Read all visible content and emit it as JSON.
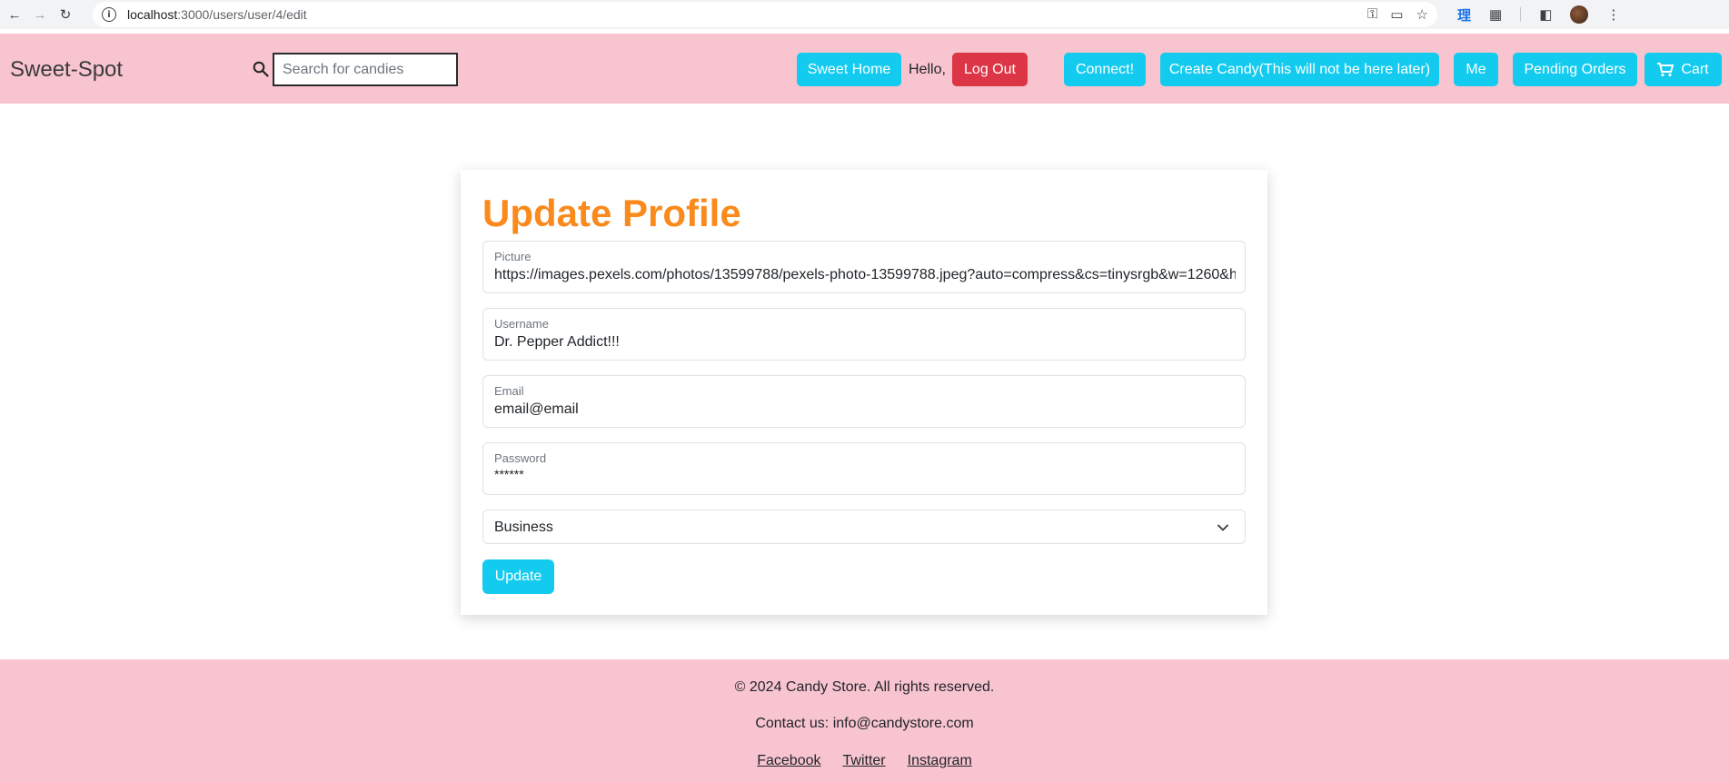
{
  "browser": {
    "url_host": "localhost",
    "url_path": ":3000/users/user/4/edit"
  },
  "navbar": {
    "brand": "Sweet-Spot",
    "search_placeholder": "Search for candies",
    "sweet_home": "Sweet Home",
    "hello": "Hello,",
    "logout": "Log Out",
    "connect": "Connect!",
    "create_candy": "Create Candy(This will not be here later)",
    "me": "Me",
    "pending_orders": "Pending Orders",
    "cart": "Cart"
  },
  "form": {
    "title": "Update Profile",
    "picture_label": "Picture",
    "picture_value": "https://images.pexels.com/photos/13599788/pexels-photo-13599788.jpeg?auto=compress&cs=tinysrgb&w=1260&h=750&dpr=1",
    "username_label": "Username",
    "username_value": "Dr. Pepper Addict!!!",
    "email_label": "Email",
    "email_value": "email@email",
    "password_label": "Password",
    "password_value": "******",
    "account_type": "Business",
    "update": "Update"
  },
  "footer": {
    "copyright": "© 2024 Candy Store. All rights reserved.",
    "contact": "Contact us: info@candystore.com",
    "links": [
      "Facebook",
      "Twitter",
      "Instagram"
    ]
  },
  "colors": {
    "navbar_bg": "#f8c4d0",
    "primary": "#13cbef",
    "danger": "#dc3545",
    "title": "#fa8a1c"
  }
}
